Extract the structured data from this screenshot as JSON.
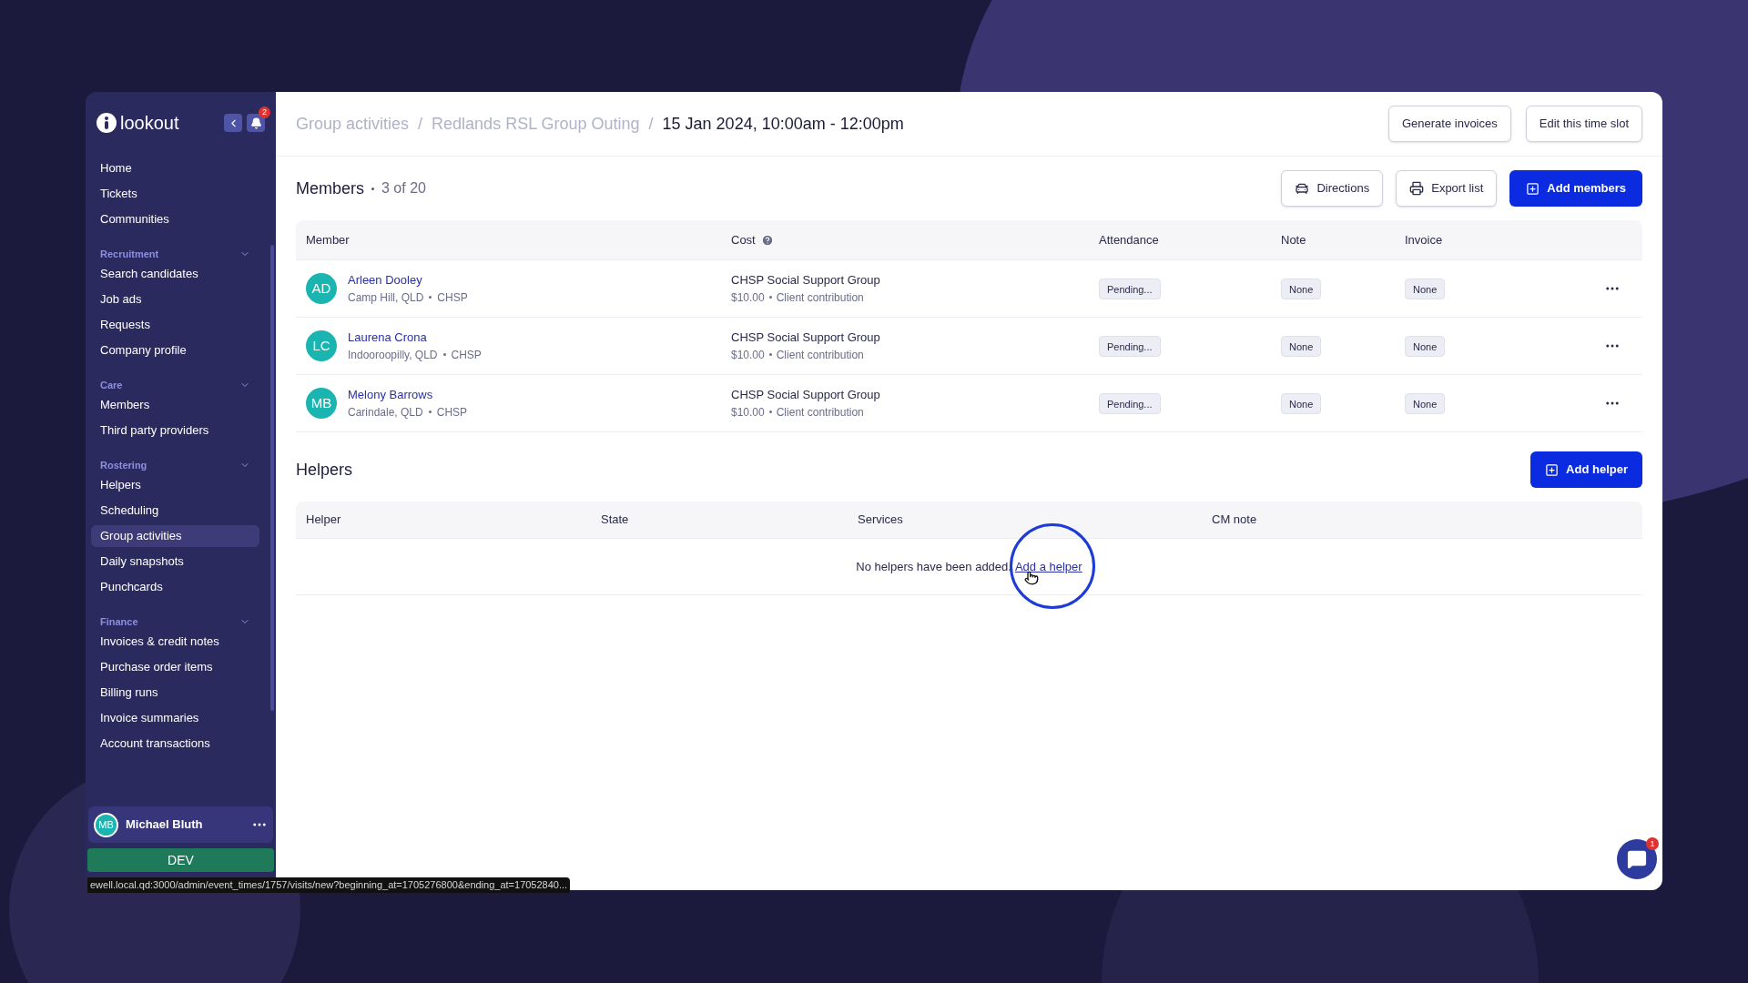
{
  "sidebar": {
    "logo": "lookout",
    "notification_count": "2",
    "top_items": [
      {
        "label": "Home",
        "selected": false
      },
      {
        "label": "Tickets",
        "selected": false
      },
      {
        "label": "Communities",
        "selected": false
      }
    ],
    "sections": [
      {
        "title": "Recruitment",
        "expanded": true,
        "items": [
          {
            "label": "Search candidates",
            "selected": false
          },
          {
            "label": "Job ads",
            "selected": false
          },
          {
            "label": "Requests",
            "selected": false
          },
          {
            "label": "Company profile",
            "selected": false
          }
        ]
      },
      {
        "title": "Care",
        "expanded": true,
        "items": [
          {
            "label": "Members",
            "selected": false
          },
          {
            "label": "Third party providers",
            "selected": false
          }
        ]
      },
      {
        "title": "Rostering",
        "expanded": true,
        "items": [
          {
            "label": "Helpers",
            "selected": false
          },
          {
            "label": "Scheduling",
            "selected": false
          },
          {
            "label": "Group activities",
            "selected": true
          },
          {
            "label": "Daily snapshots",
            "selected": false
          },
          {
            "label": "Punchcards",
            "selected": false
          }
        ]
      },
      {
        "title": "Finance",
        "expanded": true,
        "items": [
          {
            "label": "Invoices & credit notes",
            "selected": false
          },
          {
            "label": "Purchase order items",
            "selected": false
          },
          {
            "label": "Billing runs",
            "selected": false
          },
          {
            "label": "Invoice summaries",
            "selected": false
          },
          {
            "label": "Account transactions",
            "selected": false
          }
        ]
      }
    ],
    "user": {
      "initials": "MB",
      "name": "Michael Bluth"
    },
    "environment": "DEV"
  },
  "breadcrumb_separator": "/",
  "breadcrumb": [
    "Group activities",
    "Redlands RSL Group Outing",
    "15 Jan 2024, 10:00am - 12:00pm"
  ],
  "header_buttons": [
    "Generate invoices",
    "Edit this time slot"
  ],
  "members": {
    "title": "Members",
    "count": "3 of 20",
    "buttons": [
      {
        "label": "Directions",
        "kind": "car"
      },
      {
        "label": "Export list",
        "kind": "printer"
      },
      {
        "label": "Add members",
        "kind": "primary"
      }
    ],
    "columns": [
      "Member",
      "Cost",
      "Attendance",
      "Note",
      "Invoice"
    ],
    "rows": [
      {
        "initials": "AD",
        "name": "Arleen Dooley",
        "location": "Camp Hill, QLD",
        "program": "CHSP",
        "service": "CHSP Social Support Group",
        "price": "$10.00",
        "contribution": "Client contribution",
        "attendance": "Pending...",
        "note": "None",
        "invoice": "None"
      },
      {
        "initials": "LC",
        "name": "Laurena Crona",
        "location": "Indooroopilly, QLD",
        "program": "CHSP",
        "service": "CHSP Social Support Group",
        "price": "$10.00",
        "contribution": "Client contribution",
        "attendance": "Pending...",
        "note": "None",
        "invoice": "None"
      },
      {
        "initials": "MB",
        "name": "Melony Barrows",
        "location": "Carindale, QLD",
        "program": "CHSP",
        "service": "CHSP Social Support Group",
        "price": "$10.00",
        "contribution": "Client contribution",
        "attendance": "Pending...",
        "note": "None",
        "invoice": "None"
      }
    ]
  },
  "helpers": {
    "title": "Helpers",
    "add_button": "Add helper",
    "columns": [
      "Helper",
      "State",
      "Services",
      "CM note"
    ],
    "empty_message": "No helpers have been added.",
    "empty_link": "Add a helper"
  },
  "chat_badge": "1",
  "status_url": "ewell.local.qd:3000/admin/event_times/1757/visits/new?beginning_at=1705276800&ending_at=17052840..."
}
